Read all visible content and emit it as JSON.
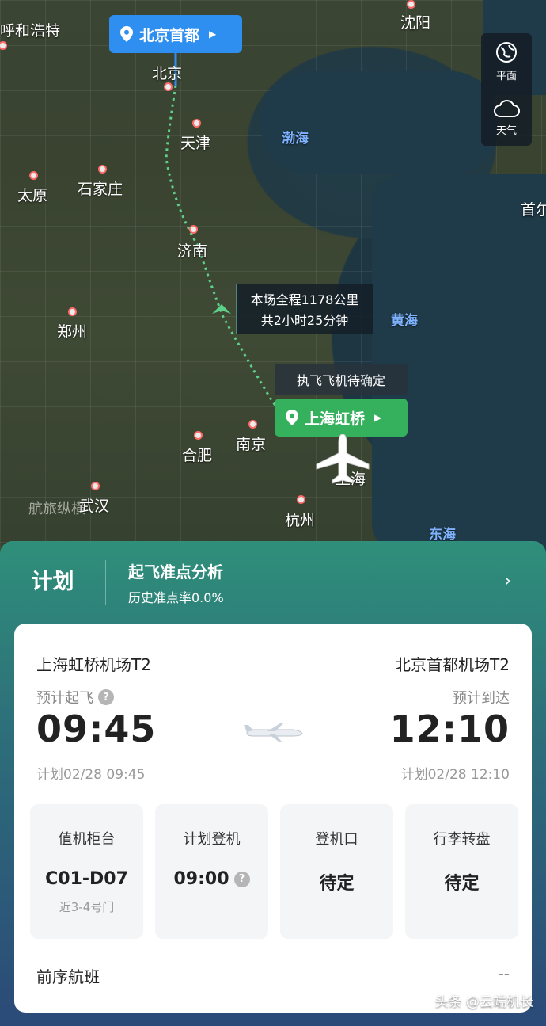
{
  "map": {
    "origin_pin": "北京首都",
    "destination_pin": "上海虹桥",
    "route_info_line1": "本场全程1178公里",
    "route_info_line2": "共2小时25分钟",
    "aircraft_pending": "执飞飞机待确定",
    "controls": {
      "flat": "平面",
      "weather": "天气"
    },
    "cities": [
      "呼和浩特",
      "沈阳",
      "北京",
      "天津",
      "石家庄",
      "太原",
      "济南",
      "郑州",
      "合肥",
      "南京",
      "上海",
      "杭州",
      "武汉",
      "首尔"
    ],
    "seas": [
      "渤海",
      "黄海",
      "东海"
    ],
    "watermark": "航旅纵横",
    "route_color": "#5fd08a"
  },
  "panel": {
    "title": "计划",
    "analysis_title": "起飞准点分析",
    "analysis_sub": "历史准点率0.0%"
  },
  "flight": {
    "dep_airport": "上海虹桥机场T2",
    "arr_airport": "北京首都机场T2",
    "dep_label": "预计起飞",
    "arr_label": "预计到达",
    "dep_time": "09:45",
    "arr_time": "12:10",
    "dep_plan": "计划02/28 09:45",
    "arr_plan": "计划02/28 12:10"
  },
  "info": [
    {
      "label": "值机柜台",
      "value": "C01-D07",
      "sub": "近3-4号门"
    },
    {
      "label": "计划登机",
      "value": "09:00",
      "sub": ""
    },
    {
      "label": "登机口",
      "value": "待定",
      "sub": ""
    },
    {
      "label": "行李转盘",
      "value": "待定",
      "sub": ""
    }
  ],
  "previous": {
    "label": "前序航班",
    "value": "--"
  },
  "watermark": "头条 @云端机长"
}
